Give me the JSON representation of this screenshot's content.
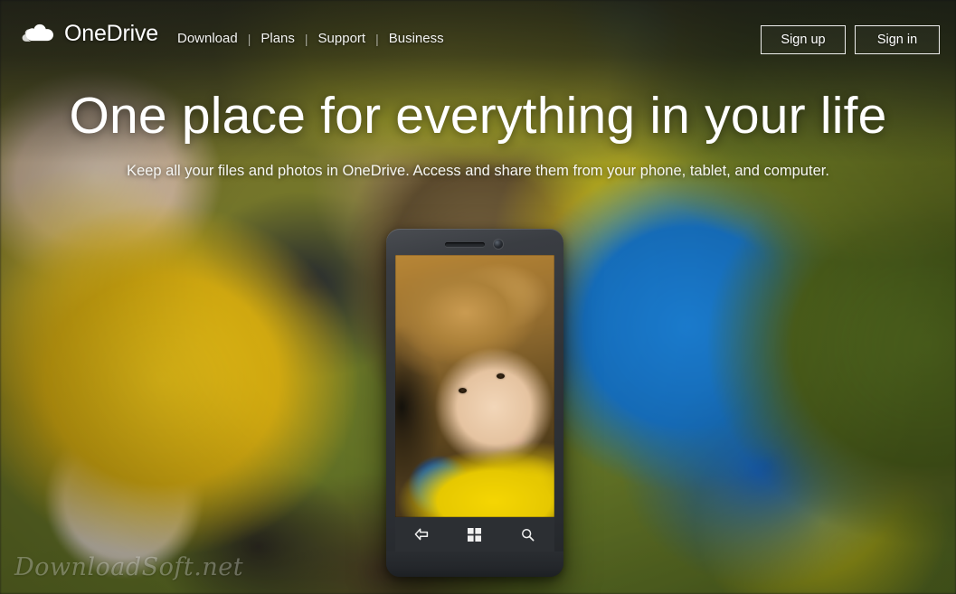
{
  "header": {
    "brand": {
      "name": "OneDrive",
      "icon": "cloud-icon"
    },
    "nav": [
      {
        "label": "Download"
      },
      {
        "label": "Plans"
      },
      {
        "label": "Support"
      },
      {
        "label": "Business"
      }
    ],
    "separator": "|",
    "auth": {
      "sign_up_label": "Sign up",
      "sign_in_label": "Sign in"
    }
  },
  "hero": {
    "title": "One place for everything in your life",
    "subtitle": "Keep all your files and photos in OneDrive. Access and share them from your phone, tablet, and computer."
  },
  "phone": {
    "navbar": [
      {
        "icon": "back-arrow-icon"
      },
      {
        "icon": "windows-start-icon"
      },
      {
        "icon": "search-icon"
      }
    ]
  },
  "watermark": {
    "text": "DownloadSoft.net"
  },
  "colors": {
    "text_on_dark": "#ffffff",
    "button_border": "#ffffff",
    "phone_body": "#2f3236",
    "phone_navbar": "#2c2f33",
    "jersey_yellow": "#e8c220",
    "jersey_blue": "#1f7fd0",
    "grass_green": "#6e7c28"
  }
}
